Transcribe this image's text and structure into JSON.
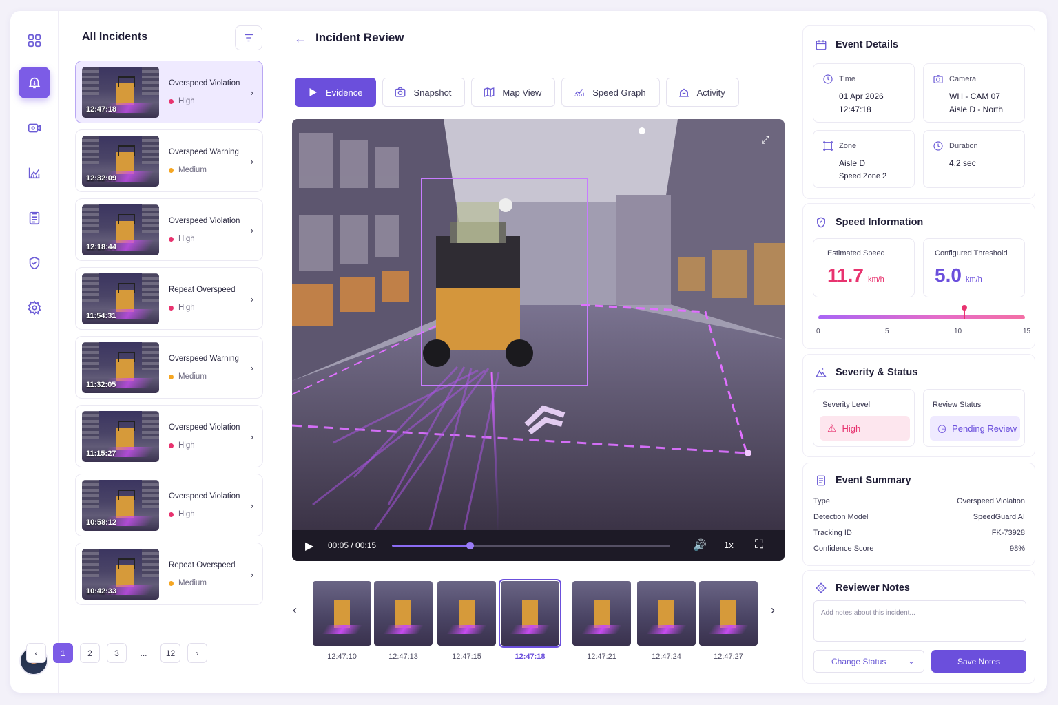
{
  "list": {
    "title": "All Incidents",
    "items": [
      {
        "title": "Overspeed Violation",
        "severity": "High",
        "time": "12:47:18"
      },
      {
        "title": "Overspeed Warning",
        "severity": "Medium",
        "time": "12:32:09"
      },
      {
        "title": "Overspeed Violation",
        "severity": "High",
        "time": "12:18:44"
      },
      {
        "title": "Repeat Overspeed",
        "severity": "High",
        "time": "11:54:31"
      },
      {
        "title": "Overspeed Warning",
        "severity": "Medium",
        "time": "11:32:05"
      },
      {
        "title": "Overspeed Violation",
        "severity": "High",
        "time": "11:15:27"
      },
      {
        "title": "Overspeed Violation",
        "severity": "High",
        "time": "10:58:12"
      },
      {
        "title": "Repeat Overspeed",
        "severity": "Medium",
        "time": "10:42:33"
      }
    ],
    "pagination": {
      "pages": [
        "1",
        "2",
        "3",
        "...",
        "12"
      ],
      "current": "1"
    }
  },
  "main": {
    "title": "Incident Review",
    "tabs": [
      "Evidence",
      "Snapshot",
      "Map View",
      "Speed Graph",
      "Activity"
    ],
    "video": {
      "time": "00:05 / 00:15",
      "progress": 0.28,
      "speed": "1x"
    },
    "frames": [
      "12:47:10",
      "12:47:13",
      "12:47:15",
      "12:47:18",
      "12:47:21",
      "12:47:24",
      "12:47:27"
    ]
  },
  "details": {
    "title": "Event Details",
    "time_label": "Time",
    "date": "01 Apr 2026",
    "time": "12:47:18",
    "camera_label": "Camera",
    "camera": "WH - CAM 07",
    "camera_loc": "Aisle D - North",
    "zone_label": "Zone",
    "zone": "Aisle D",
    "zone_sub": "Speed Zone 2",
    "duration_label": "Duration",
    "duration": "4.2 sec"
  },
  "speed": {
    "title": "Speed Information",
    "est_label": "Estimated Speed",
    "est_value": "11.7",
    "unit": "km/h",
    "thr_label": "Configured Threshold",
    "thr_value": "5.0",
    "scale_ticks": [
      "0",
      "5",
      "10",
      "15"
    ],
    "marker_value": 10.6
  },
  "severity": {
    "title": "Severity & Status",
    "level_label": "Severity Level",
    "level": "High",
    "status_label": "Review Status",
    "status": "Pending Review"
  },
  "summary": {
    "title": "Event Summary",
    "rows": [
      {
        "k": "Type",
        "v": "Overspeed Violation"
      },
      {
        "k": "Detection Model",
        "v": "SpeedGuard AI"
      },
      {
        "k": "Tracking ID",
        "v": "FK-73928"
      },
      {
        "k": "Confidence Score",
        "v": "98%"
      }
    ]
  },
  "notes": {
    "title": "Reviewer Notes",
    "placeholder": "Add notes about this incident...",
    "change_status": "Change Status",
    "save": "Save Notes"
  },
  "colors": {
    "accent": "#6b4fdc",
    "high": "#e8336f",
    "medium": "#f5a623"
  }
}
